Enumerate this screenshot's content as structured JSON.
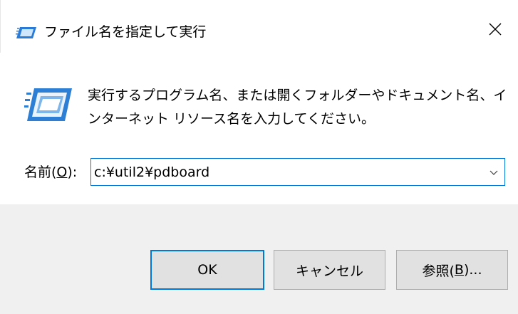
{
  "window": {
    "title": "ファイル名を指定して実行",
    "close_icon": "close-icon"
  },
  "prompt": {
    "line1": "実行するプログラム名、または開くフォルダーやドキュメント名、イ",
    "line2": "ンターネット リソース名を入力してください。",
    "icon": "run-icon"
  },
  "name_field": {
    "label_prefix": "名前(",
    "label_accel": "O",
    "label_suffix": "):",
    "value": "c:¥util2¥pdboard",
    "dropdown_icon": "chevron-down-icon"
  },
  "buttons": {
    "ok": "OK",
    "cancel": "キャンセル",
    "browse_prefix": "参照(",
    "browse_accel": "B",
    "browse_suffix": ")..."
  },
  "colors": {
    "accent": "#0078d7",
    "footer_bg": "#f0f0f0",
    "button_bg": "#e1e1e1"
  }
}
